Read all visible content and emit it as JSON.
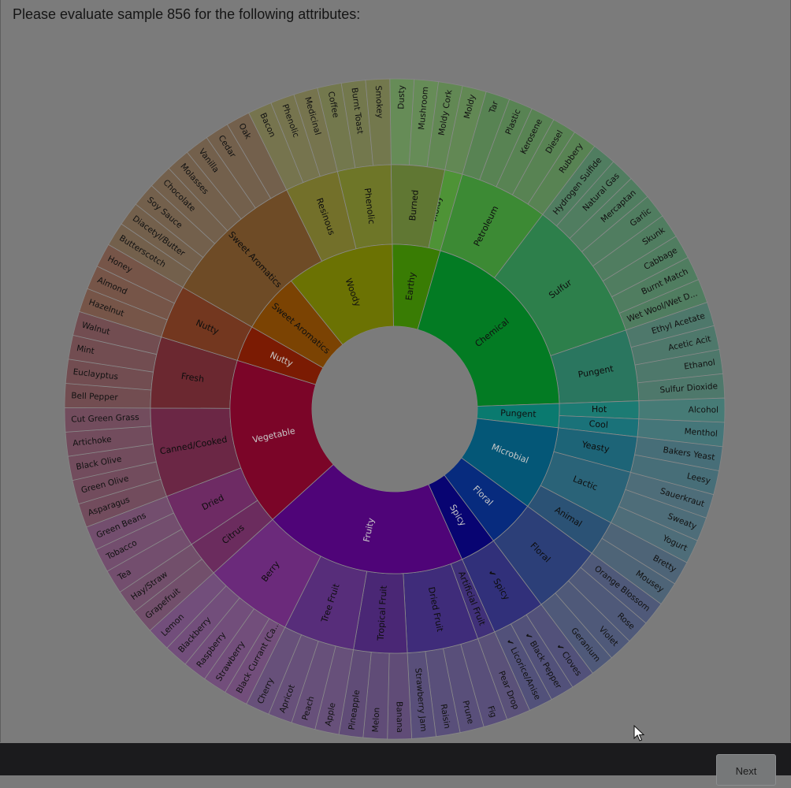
{
  "prompt": "Please evaluate sample 856 for the following attributes:",
  "next_label": "Next",
  "wheel": {
    "outer": [
      "Dusty",
      "Mushroom",
      "Moldy Cork",
      "Moldy",
      "Tar",
      "Plastic",
      "Kerosene",
      "Diesel",
      "Rubbery",
      "Hydrogen Sulfide",
      "Natural Gas",
      "Mercaptan",
      "Garlic",
      "Skunk",
      "Cabbage",
      "Burnt Match",
      "Wet Wool/Wet D...",
      "Ethyl Acetate",
      "Acetic Acit",
      "Ethanol",
      "Sulfur Dioxide",
      "Alcohol",
      "Menthol",
      "Bakers Yeast",
      "Leesy",
      "Sauerkraut",
      "Sweaty",
      "Yogurt",
      "Bretty",
      "Mousey",
      "Orange Blossom",
      "Rose",
      "Violet",
      "Geranium",
      "✔ Cloves",
      "✔ Black Pepper",
      "✔ Licorice/Anise",
      "Pear Drop",
      "Fig",
      "Prune",
      "Raisin",
      "Strawberry Jam",
      "Banana",
      "Melon",
      "Pineapple",
      "Apple",
      "Peach",
      "Apricot",
      "Cherry",
      "Black Currant (Ca...",
      "Strawberry",
      "Raspberry",
      "Blackberry",
      "Lemon",
      "Grapefruit",
      "Hay/Straw",
      "Tea",
      "Tobacco",
      "Green Beans",
      "Asparagus",
      "Green Olive",
      "Black Olive",
      "Artichoke",
      "Cut Green Grass",
      "Bell Pepper",
      "Euclayptus",
      "Mint",
      "Walnut",
      "Hazelnut",
      "Almond",
      "Honey",
      "Butterscotch",
      "Diacetyl/Butter",
      "Soy Sauce",
      "Chocolate",
      "Molasses",
      "Vanilla",
      "Cedar",
      "Oak",
      "Bacon",
      "Phenolic",
      "Medicinal",
      "Coffee",
      "Burnt Toast",
      "Smokey"
    ],
    "middle": [
      {
        "label": "Earthy",
        "color": "#569b3a",
        "span": 2
      },
      {
        "label": "Moldy",
        "color": "#4e9336",
        "span": 2
      },
      {
        "label": "Petroleum",
        "color": "#3c8a34",
        "span": 5
      },
      {
        "label": "Sulfur",
        "color": "#2d7f4b",
        "span": 8
      },
      {
        "label": "Pungent",
        "color": "#2a765f",
        "span": 4
      },
      {
        "label": "Hot",
        "color": "#1c7b73",
        "span": 1
      },
      {
        "label": "Cool",
        "color": "#1a7279",
        "span": 1
      },
      {
        "label": "Yeasty",
        "color": "#1d6477",
        "span": 2
      },
      {
        "label": "Lactic",
        "color": "#2a6378",
        "span": 3
      },
      {
        "label": "Animal",
        "color": "#2b5275",
        "span": 2
      },
      {
        "label": "Floral",
        "color": "#2c3f78",
        "span": 4
      },
      {
        "label": "✔ Spicy",
        "color": "#31307a",
        "span": 3
      },
      {
        "label": "Artificial Fruit",
        "color": "#403079",
        "span": 1
      },
      {
        "label": "Dried Fruit",
        "color": "#3f2c7a",
        "span": 4
      },
      {
        "label": "Tropical Fruit",
        "color": "#4a2775",
        "span": 3
      },
      {
        "label": "Tree Fruit",
        "color": "#572d7a",
        "span": 4
      },
      {
        "label": "Berry",
        "color": "#6b2a7b",
        "span": 5
      },
      {
        "label": "Citrus",
        "color": "#6b2c5e",
        "span": 2
      },
      {
        "label": "Dried",
        "color": "#6e2b64",
        "span": 3
      },
      {
        "label": "Canned/Cooked",
        "color": "#6b2745",
        "span": 5
      },
      {
        "label": "Fresh",
        "color": "#6b2830",
        "span": 4
      },
      {
        "label": "Nutty",
        "color": "#73371f",
        "span": 3
      },
      {
        "label": "Sweet Aromatics",
        "color": "#6e4b26",
        "span": 8
      },
      {
        "label": "Resinous",
        "color": "#73702a",
        "span": 3
      },
      {
        "label": "Phenolic",
        "color": "#6e7628",
        "span": 3
      },
      {
        "label": "Burned",
        "color": "#607733",
        "span": 3
      }
    ],
    "inner": [
      {
        "label": "Earthy",
        "color": "#397c04",
        "span": 4
      },
      {
        "label": "Chemical",
        "color": "#037b23",
        "span": 17
      },
      {
        "label": "Pungent",
        "color": "#0a7a6f",
        "span": 2
      },
      {
        "label": "Microbial",
        "color": "#045777",
        "span": 7
      },
      {
        "label": "Floral",
        "color": "#072b7e",
        "span": 4
      },
      {
        "label": "Spicy",
        "color": "#080472",
        "span": 3
      },
      {
        "label": "Fruity",
        "color": "#4f0478",
        "span": 17
      },
      {
        "label": "Vegetable",
        "color": "#7b0528",
        "span": 14
      },
      {
        "label": "Nutty",
        "color": "#7b1b03",
        "span": 3
      },
      {
        "label": "Sweet Aromatics",
        "color": "#7b4303",
        "span": 5
      },
      {
        "label": "Woody",
        "color": "#6b7203",
        "span": 9
      }
    ]
  }
}
